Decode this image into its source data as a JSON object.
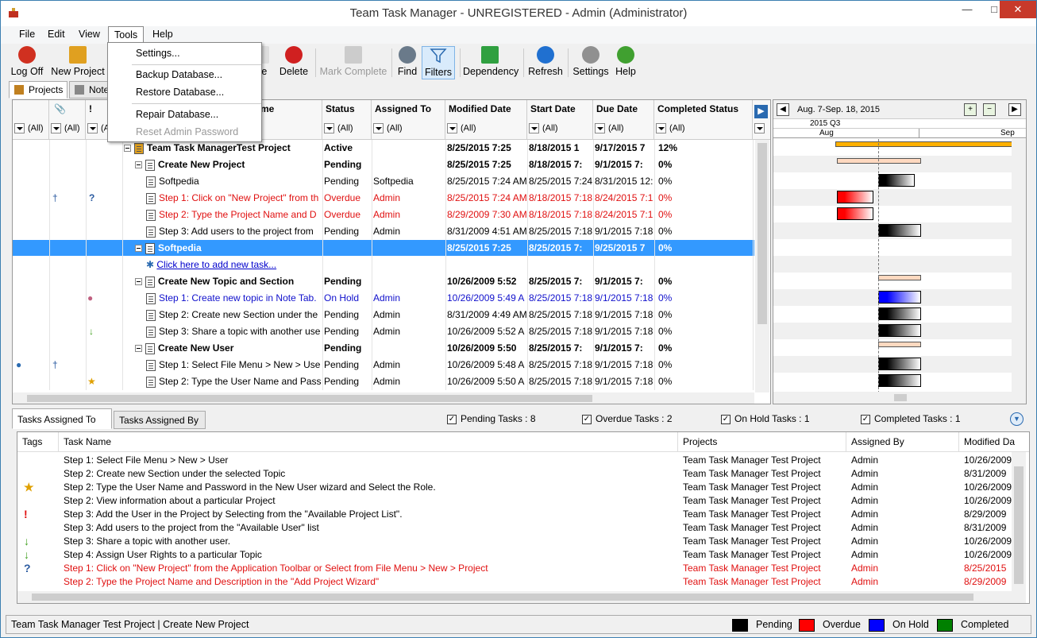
{
  "window": {
    "title": "Team Task Manager - UNREGISTERED - Admin (Administrator)"
  },
  "menu": {
    "file": "File",
    "edit": "Edit",
    "view": "View",
    "tools": "Tools",
    "help": "Help"
  },
  "tools_menu": {
    "settings": "Settings...",
    "backup": "Backup Database...",
    "restore": "Restore Database...",
    "repair": "Repair Database...",
    "reset": "Reset Admin Password"
  },
  "toolbar": {
    "logoff": "Log Off",
    "new_project": "New Project",
    "paste": "ste",
    "delete": "Delete",
    "mark_complete": "Mark Complete",
    "find": "Find",
    "filters": "Filters",
    "dependency": "Dependency",
    "refresh": "Refresh",
    "settings": "Settings",
    "help": "Help"
  },
  "panel_tabs": {
    "projects": "Projects",
    "notes": "Note"
  },
  "grid": {
    "headers": {
      "name": "me",
      "status": "Status",
      "assigned": "Assigned To",
      "modified": "Modified Date",
      "start": "Start Date",
      "due": "Due Date",
      "completed": "Completed Status",
      "tag": "!"
    },
    "filter_all": "(All)",
    "rows": [
      {
        "name": "Team Task ManagerTest Project",
        "status": "Active",
        "assigned": "",
        "modified": "8/25/2015 7:25",
        "start": "8/18/2015 1",
        "due": "9/17/2015 7",
        "completed": "12%",
        "style": "b",
        "indent": 0,
        "exp": true
      },
      {
        "name": "Create New Project",
        "status": "Pending",
        "assigned": "",
        "modified": "8/25/2015 7:25",
        "start": "8/18/2015 7:",
        "due": "9/1/2015 7:",
        "completed": "0%",
        "style": "b",
        "indent": 1,
        "exp": true
      },
      {
        "name": "Softpedia",
        "status": "Pending",
        "assigned": "Softpedia",
        "modified": "8/25/2015 7:24 AM",
        "start": "8/25/2015 7:24",
        "due": "8/31/2015 12:",
        "completed": "0%",
        "style": "",
        "indent": 2
      },
      {
        "name": "Step 1: Click on \"New Project\" from th",
        "status": "Overdue",
        "assigned": "Admin",
        "modified": "8/25/2015 7:24 AM",
        "start": "8/18/2015 7:18",
        "due": "8/24/2015 7:1",
        "completed": "0%",
        "style": "red",
        "indent": 2
      },
      {
        "name": "Step 2: Type the Project Name and D",
        "status": "Overdue",
        "assigned": "Admin",
        "modified": "8/29/2009 7:30 AM",
        "start": "8/18/2015 7:18",
        "due": "8/24/2015 7:1",
        "completed": "0%",
        "style": "red",
        "indent": 2
      },
      {
        "name": "Step 3: Add users to the project from",
        "status": "Pending",
        "assigned": "Admin",
        "modified": "8/31/2009 4:51 AM",
        "start": "8/25/2015 7:18",
        "due": "9/1/2015 7:18",
        "completed": "0%",
        "style": "",
        "indent": 2
      },
      {
        "name": "Softpedia",
        "status": "",
        "assigned": "",
        "modified": "8/25/2015 7:25",
        "start": "8/25/2015 7:",
        "due": "9/25/2015 7",
        "completed": "0%",
        "style": "selr",
        "indent": 1,
        "exp": true
      },
      {
        "name": "Click here to add new task...",
        "status": "",
        "assigned": "",
        "modified": "",
        "start": "",
        "due": "",
        "completed": "",
        "style": "link",
        "indent": 2
      },
      {
        "name": "Create New Topic and Section",
        "status": "Pending",
        "assigned": "",
        "modified": "10/26/2009 5:52",
        "start": "8/25/2015 7:",
        "due": "9/1/2015 7:",
        "completed": "0%",
        "style": "b",
        "indent": 1,
        "exp": true
      },
      {
        "name": "Step 1: Create new topic in Note Tab.",
        "status": "On Hold",
        "assigned": "Admin",
        "modified": "10/26/2009 5:49 A",
        "start": "8/25/2015 7:18",
        "due": "9/1/2015 7:18",
        "completed": "0%",
        "style": "blue",
        "indent": 2
      },
      {
        "name": "Step 2: Create new Section under the",
        "status": "Pending",
        "assigned": "Admin",
        "modified": "8/31/2009 4:49 AM",
        "start": "8/25/2015 7:18",
        "due": "9/1/2015 7:18",
        "completed": "0%",
        "style": "",
        "indent": 2
      },
      {
        "name": "Step 3: Share a topic with another use",
        "status": "Pending",
        "assigned": "Admin",
        "modified": "10/26/2009 5:52 A",
        "start": "8/25/2015 7:18",
        "due": "9/1/2015 7:18",
        "completed": "0%",
        "style": "",
        "indent": 2
      },
      {
        "name": "Create New User",
        "status": "Pending",
        "assigned": "",
        "modified": "10/26/2009 5:50",
        "start": "8/25/2015 7:",
        "due": "9/1/2015 7:",
        "completed": "0%",
        "style": "b",
        "indent": 1,
        "exp": true
      },
      {
        "name": "Step 1: Select File Menu > New > Use",
        "status": "Pending",
        "assigned": "Admin",
        "modified": "10/26/2009 5:48 A",
        "start": "8/25/2015 7:18",
        "due": "9/1/2015 7:18",
        "completed": "0%",
        "style": "",
        "indent": 2
      },
      {
        "name": "Step 2: Type the User Name and Pass",
        "status": "Pending",
        "assigned": "Admin",
        "modified": "10/26/2009 5:50 A",
        "start": "8/25/2015 7:18",
        "due": "9/1/2015 7:18",
        "completed": "0%",
        "style": "",
        "indent": 2
      }
    ]
  },
  "gantt": {
    "range": "Aug. 7-Sep. 18, 2015",
    "quarter": "2015 Q3",
    "month1": "Aug",
    "month2": "Sep"
  },
  "bottom": {
    "tab1": "Tasks Assigned To Me",
    "tab2": "Tasks Assigned By Me",
    "pending": "Pending Tasks : 8",
    "overdue": "Overdue Tasks : 2",
    "onhold": "On Hold Tasks : 1",
    "completed": "Completed Tasks : 1",
    "headers": {
      "tags": "Tags",
      "name": "Task Name",
      "projects": "Projects",
      "by": "Assigned By",
      "mod": "Modified Da"
    },
    "rows": [
      {
        "tag": "",
        "name": "Step 1: Select File Menu > New > User",
        "project": "Team Task Manager Test Project",
        "by": "Admin",
        "mod": "10/26/2009",
        "red": false
      },
      {
        "tag": "",
        "name": "Step 2: Create new Section under the selected Topic",
        "project": "Team Task Manager Test Project",
        "by": "Admin",
        "mod": "8/31/2009",
        "red": false
      },
      {
        "tag": "star",
        "name": "Step 2: Type the User Name and Password in the New User wizard and Select the Role.",
        "project": "Team Task Manager Test Project",
        "by": "Admin",
        "mod": "10/26/2009",
        "red": false
      },
      {
        "tag": "",
        "name": "Step 2: View information about a particular Project",
        "project": "Team Task Manager Test Project",
        "by": "Admin",
        "mod": "10/26/2009",
        "red": false
      },
      {
        "tag": "excl",
        "name": "Step 3: Add the User in the Project by Selecting from the \"Available Project List\".",
        "project": "Team Task Manager Test Project",
        "by": "Admin",
        "mod": "8/29/2009",
        "red": false
      },
      {
        "tag": "",
        "name": "Step 3: Add users to the project from the \"Available User\" list",
        "project": "Team Task Manager Test Project",
        "by": "Admin",
        "mod": "8/31/2009",
        "red": false
      },
      {
        "tag": "down",
        "name": "Step 3: Share a topic with another user.",
        "project": "Team Task Manager Test Project",
        "by": "Admin",
        "mod": "10/26/2009",
        "red": false
      },
      {
        "tag": "down",
        "name": "Step 4: Assign User Rights to a particular Topic",
        "project": "Team Task Manager Test Project",
        "by": "Admin",
        "mod": "10/26/2009",
        "red": false
      },
      {
        "tag": "q",
        "name": "Step 1: Click on \"New Project\" from the Application Toolbar or Select from File Menu > New > Project",
        "project": "Team Task Manager Test Project",
        "by": "Admin",
        "mod": "8/25/2015",
        "red": true
      },
      {
        "tag": "",
        "name": "Step 2: Type the Project Name and Description in the \"Add Project Wizard\"",
        "project": "Team Task Manager Test Project",
        "by": "Admin",
        "mod": "8/29/2009",
        "red": true
      }
    ]
  },
  "status": {
    "path": "Team Task Manager Test Project  | Create New Project",
    "legend": {
      "pending": "Pending",
      "overdue": "Overdue",
      "onhold": "On Hold",
      "completed": "Completed"
    },
    "colors": {
      "pending": "#000000",
      "overdue": "#ff0000",
      "onhold": "#0000ff",
      "completed": "#008000"
    }
  }
}
